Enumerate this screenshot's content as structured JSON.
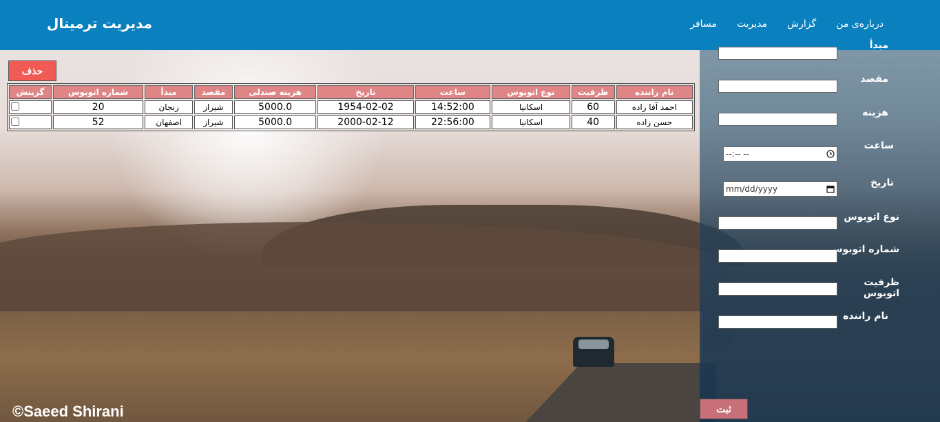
{
  "header": {
    "brand": "مدیریت ترمینال",
    "nav": [
      "درباره‌ی من",
      "گزارش",
      "مدیریت",
      "مسافر"
    ]
  },
  "table": {
    "delete_label": "حذف",
    "columns": [
      "نام راننده",
      "ظرفیت",
      "نوع اتوبوس",
      "ساعت",
      "تاریخ",
      "هزینه صندلی",
      "مقصد",
      "مبدأ",
      "شماره اتوبوس",
      "گزینش"
    ],
    "rows": [
      [
        "احمد آقا زاده",
        "60",
        "اسکانیا",
        "14:52:00",
        "1954-02-02",
        "5000.0",
        "شیراز",
        "زنجان",
        "20"
      ],
      [
        "حسن زاده",
        "40",
        "اسکانیا",
        "22:56:00",
        "2000-02-12",
        "5000.0",
        "شیراز",
        "اصفهان",
        "52"
      ]
    ]
  },
  "form": {
    "origin_label": "مبدأ",
    "destination_label": "مقصد",
    "cost_label": "هزینه",
    "time_label": "ساعت",
    "time_placeholder": "--:-- --",
    "date_label": "تاریخ",
    "date_placeholder": "mm/dd/yyyy",
    "bus_type_label": "نوع اتوبوس",
    "bus_number_label": "شماره اتوبوس",
    "bus_capacity_label": "ظرفیت اتوبوس",
    "driver_name_label": "نام راننده",
    "submit_label": "ثبت"
  },
  "footer": {
    "credit": "©Saeed Shirani"
  },
  "colors": {
    "header": "#0a80be",
    "table_header": "#df8585",
    "delete_button": "#f15a55",
    "submit_button": "#c7707a"
  },
  "icons": {
    "time": "clock-icon",
    "date": "calendar-icon"
  }
}
